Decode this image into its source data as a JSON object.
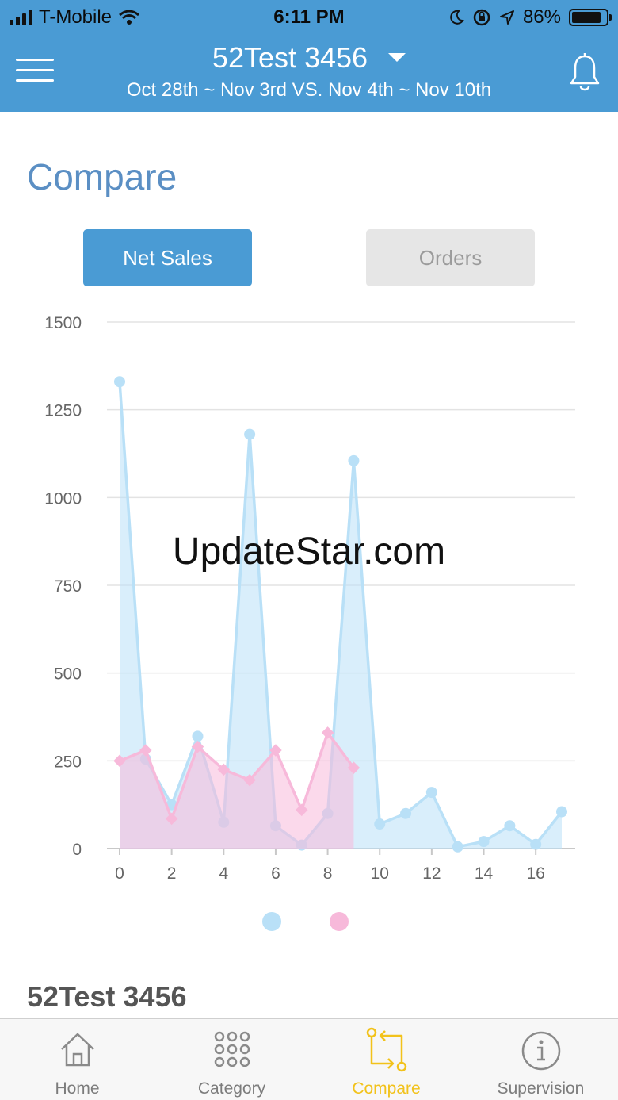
{
  "status_bar": {
    "carrier": "T-Mobile",
    "time": "6:11 PM",
    "battery": "86%",
    "battery_level": 0.86
  },
  "header": {
    "store_name": "52Test 3456",
    "date_range": "Oct 28th ~ Nov 3rd VS. Nov 4th ~ Nov 10th"
  },
  "page": {
    "title": "Compare",
    "segment": {
      "active_label": "Net Sales",
      "inactive_label": "Orders"
    },
    "watermark": "UpdateStar.com",
    "section_title": "52Test 3456"
  },
  "colors": {
    "header_bg": "#4a9bd4",
    "accent_blue": "#4a9bd4",
    "title_blue": "#5b8fc4",
    "series_blue": "#b9e0f7",
    "series_pink": "#f7b9da",
    "tab_active": "#f2c21b"
  },
  "chart_data": {
    "type": "area",
    "title": "",
    "xlabel": "",
    "ylabel": "",
    "xlim": [
      0,
      17
    ],
    "ylim": [
      0,
      1500
    ],
    "x_ticks": [
      0,
      2,
      4,
      6,
      8,
      10,
      12,
      14,
      16
    ],
    "y_ticks": [
      0,
      250,
      500,
      750,
      1000,
      1250,
      1500
    ],
    "grid": true,
    "legend_position": "bottom-center",
    "series": [
      {
        "color": "#b9e0f7",
        "x": [
          0,
          1,
          2,
          3,
          4,
          5,
          6,
          7,
          8,
          9,
          10,
          11,
          12,
          13,
          14,
          15,
          16,
          17
        ],
        "values": [
          1330,
          255,
          125,
          320,
          75,
          1180,
          65,
          10,
          100,
          1105,
          70,
          100,
          160,
          5,
          20,
          65,
          12,
          105
        ]
      },
      {
        "color": "#f7b9da",
        "x": [
          0,
          1,
          2,
          3,
          4,
          5,
          6,
          7,
          8,
          9
        ],
        "values": [
          250,
          280,
          85,
          290,
          225,
          195,
          280,
          110,
          330,
          230
        ]
      }
    ]
  },
  "tabs": [
    {
      "label": "Home",
      "icon": "home-icon"
    },
    {
      "label": "Category",
      "icon": "grid-dots-icon"
    },
    {
      "label": "Compare",
      "icon": "compare-arrows-icon",
      "active": true
    },
    {
      "label": "Supervision",
      "icon": "info-circle-icon"
    }
  ]
}
